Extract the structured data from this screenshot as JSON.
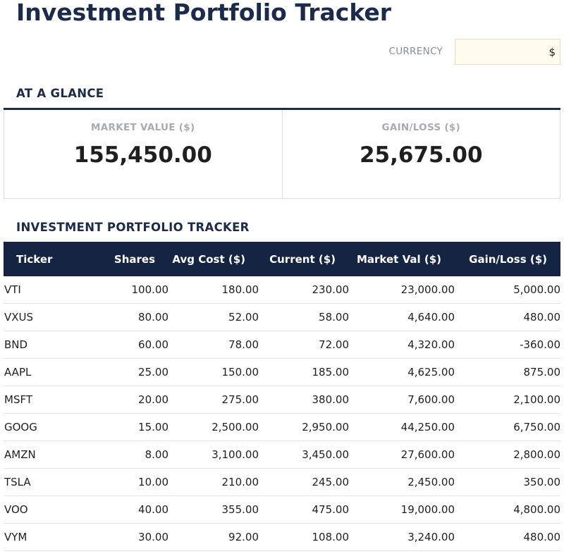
{
  "page": {
    "title": "Investment Portfolio Tracker"
  },
  "currency": {
    "label": "CURRENCY",
    "value": "$"
  },
  "glance": {
    "heading": "AT A GLANCE",
    "cards": [
      {
        "label": "MARKET VALUE ($)",
        "value": "155,450.00"
      },
      {
        "label": "GAIN/LOSS ($)",
        "value": "25,675.00"
      }
    ]
  },
  "tracker": {
    "heading": "INVESTMENT PORTFOLIO TRACKER",
    "columns": [
      "Ticker",
      "Shares",
      "Avg Cost ($)",
      "Current ($)",
      "Market Val ($)",
      "Gain/Loss ($)"
    ],
    "rows": [
      {
        "ticker": "VTI",
        "shares": "100.00",
        "avg_cost": "180.00",
        "current": "230.00",
        "market_val": "23,000.00",
        "gain_loss": "5,000.00"
      },
      {
        "ticker": "VXUS",
        "shares": "80.00",
        "avg_cost": "52.00",
        "current": "58.00",
        "market_val": "4,640.00",
        "gain_loss": "480.00"
      },
      {
        "ticker": "BND",
        "shares": "60.00",
        "avg_cost": "78.00",
        "current": "72.00",
        "market_val": "4,320.00",
        "gain_loss": "-360.00"
      },
      {
        "ticker": "AAPL",
        "shares": "25.00",
        "avg_cost": "150.00",
        "current": "185.00",
        "market_val": "4,625.00",
        "gain_loss": "875.00"
      },
      {
        "ticker": "MSFT",
        "shares": "20.00",
        "avg_cost": "275.00",
        "current": "380.00",
        "market_val": "7,600.00",
        "gain_loss": "2,100.00"
      },
      {
        "ticker": "GOOG",
        "shares": "15.00",
        "avg_cost": "2,500.00",
        "current": "2,950.00",
        "market_val": "44,250.00",
        "gain_loss": "6,750.00"
      },
      {
        "ticker": "AMZN",
        "shares": "8.00",
        "avg_cost": "3,100.00",
        "current": "3,450.00",
        "market_val": "27,600.00",
        "gain_loss": "2,800.00"
      },
      {
        "ticker": "TSLA",
        "shares": "10.00",
        "avg_cost": "210.00",
        "current": "245.00",
        "market_val": "2,450.00",
        "gain_loss": "350.00"
      },
      {
        "ticker": "VOO",
        "shares": "40.00",
        "avg_cost": "355.00",
        "current": "475.00",
        "market_val": "19,000.00",
        "gain_loss": "4,800.00"
      },
      {
        "ticker": "VYM",
        "shares": "30.00",
        "avg_cost": "92.00",
        "current": "108.00",
        "market_val": "3,240.00",
        "gain_loss": "480.00"
      }
    ]
  },
  "colors": {
    "title": "#1c2b4a",
    "header_bg": "#162443",
    "currency_input_bg": "#fffbee",
    "card_label": "#a7abb3"
  }
}
